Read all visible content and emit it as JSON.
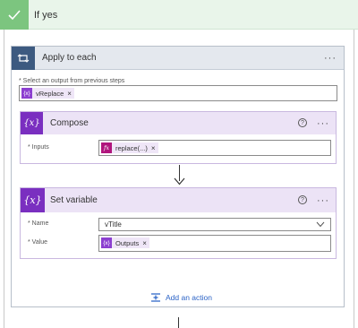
{
  "branch": {
    "title": "If yes"
  },
  "loop": {
    "title": "Apply to each",
    "more": "···",
    "field_label": "* Select an output from previous steps",
    "token": {
      "icon": "{x}",
      "label": "vReplace",
      "remove": "×"
    }
  },
  "compose": {
    "title": "Compose",
    "icon": "{x}",
    "help": "?",
    "more": "···",
    "inputs_label": "* Inputs",
    "token": {
      "icon": "fx",
      "label": "replace(...)",
      "remove": "×"
    }
  },
  "set_variable": {
    "title": "Set variable",
    "icon": "{x}",
    "help": "?",
    "more": "···",
    "name_label": "* Name",
    "name_value": "vTitle",
    "value_label": "* Value",
    "token": {
      "icon": "{x}",
      "label": "Outputs",
      "remove": "×"
    }
  },
  "add_action": {
    "label": "Add an action"
  }
}
